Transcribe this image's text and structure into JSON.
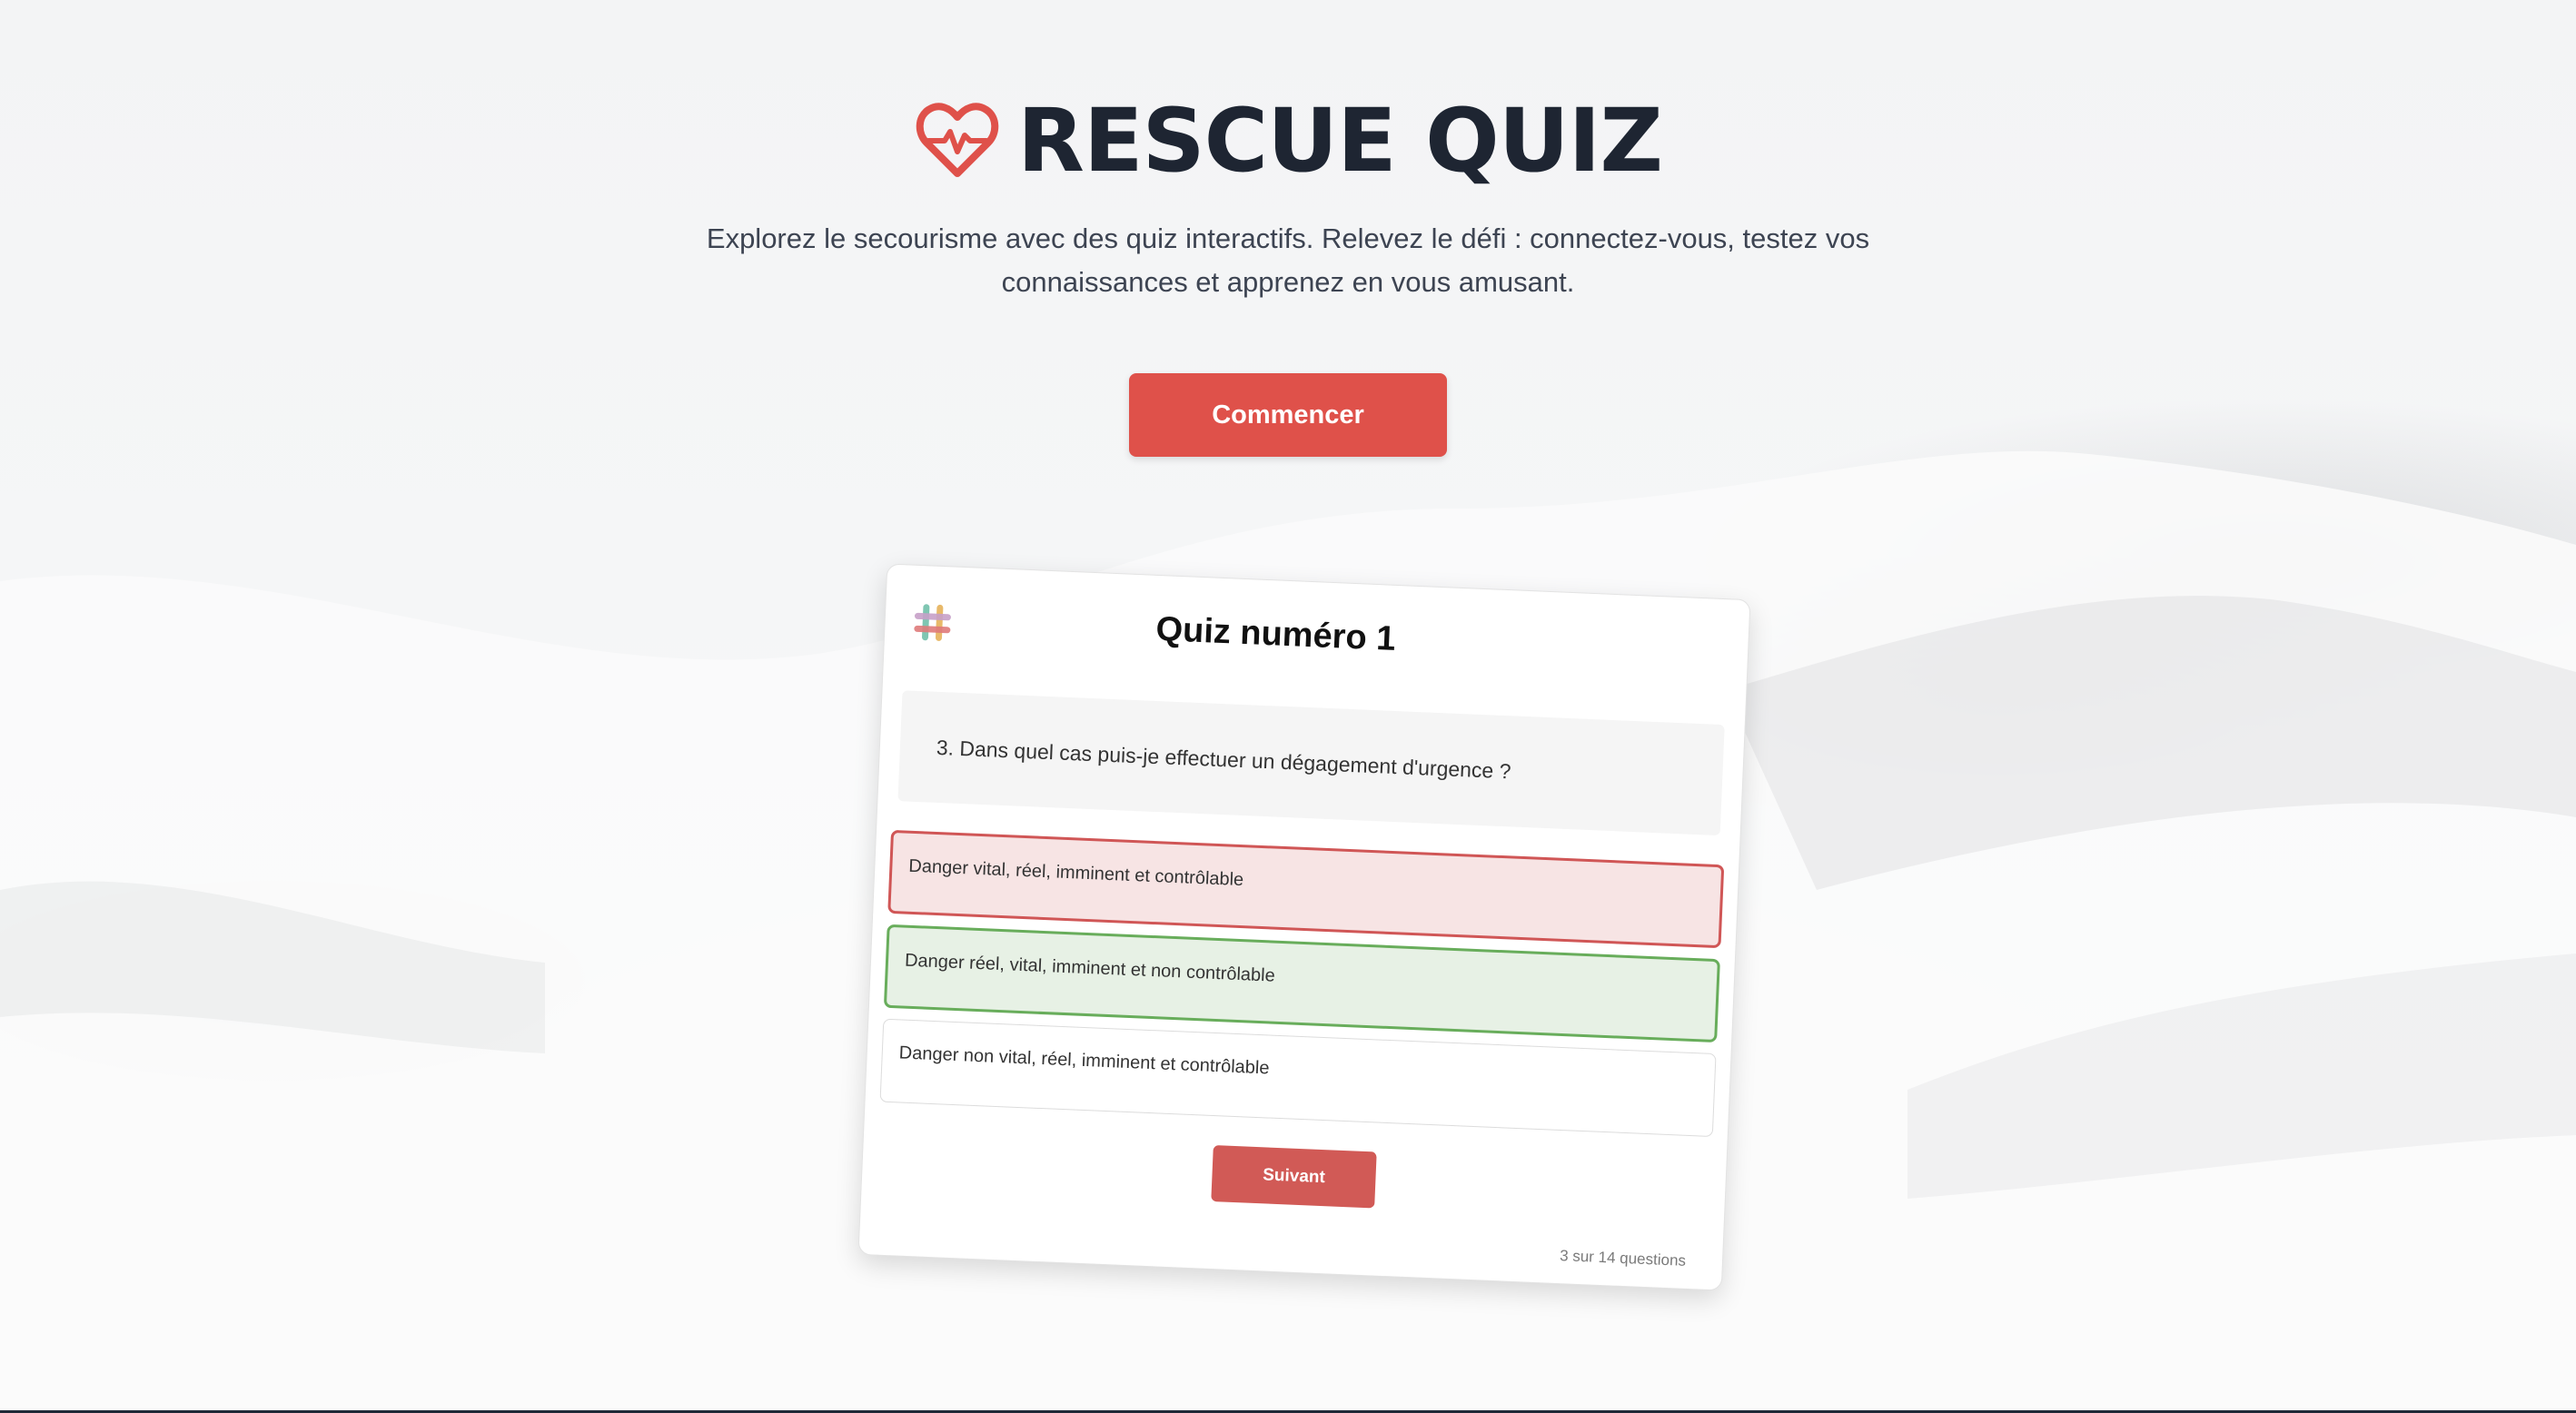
{
  "hero": {
    "title": "RESCUE QUIZ",
    "subtitle": "Explorez le secourisme avec des quiz interactifs. Relevez le défi : connectez-vous, testez vos connaissances et apprenez en vous amusant.",
    "start_label": "Commencer",
    "icon": "heart-pulse-icon"
  },
  "quiz": {
    "title": "Quiz numéro 1",
    "icon": "slack-hash-icon",
    "question": "3. Dans quel cas puis-je effectuer un dégagement d'urgence ?",
    "answers": [
      {
        "label": "Danger vital, réel, imminent et contrôlable",
        "state": "wrong"
      },
      {
        "label": "Danger réel, vital, imminent et non contrôlable",
        "state": "correct"
      },
      {
        "label": "Danger non vital, réel, imminent et contrôlable",
        "state": "neutral"
      }
    ],
    "next_label": "Suivant",
    "progress": "3 sur 14 questions"
  },
  "colors": {
    "accent": "#df514a",
    "title": "#1e2532",
    "wrong_border": "#d05656",
    "correct_border": "#68ad5b"
  }
}
